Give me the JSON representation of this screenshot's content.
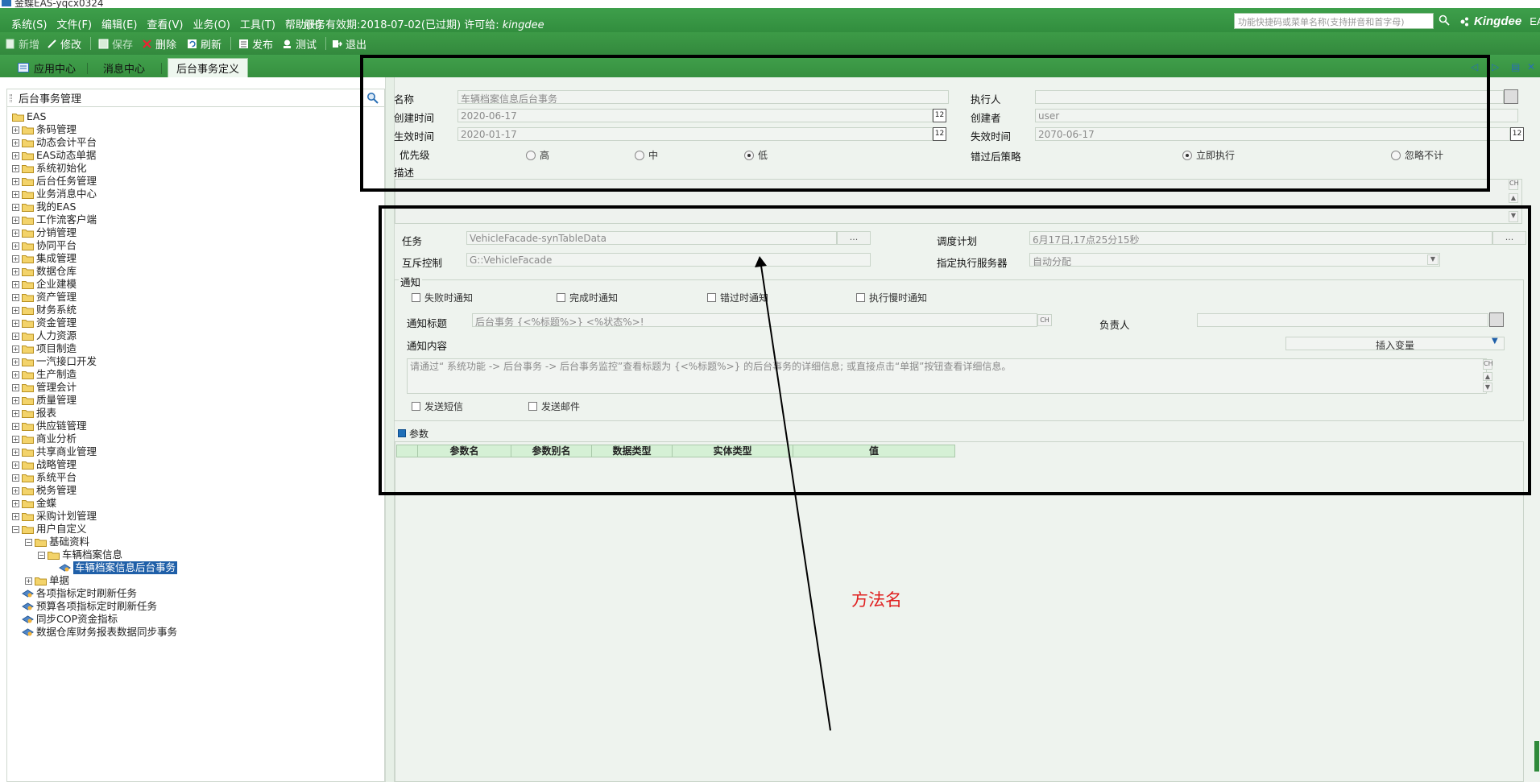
{
  "window": {
    "title": "金蝶EAS-yqcx0324"
  },
  "menubar": {
    "items": [
      "系统(S)",
      "文件(F)",
      "编辑(E)",
      "查看(V)",
      "业务(O)",
      "工具(T)",
      "帮助(H)"
    ],
    "service_text": "服务有效期:2018-07-02(已过期) 许可给:",
    "licensee": "kingdee",
    "quick_placeholder": "功能快捷码或菜单名称(支持拼音和首字母)",
    "brand": "Kingdee",
    "brand_suffix": "EAS"
  },
  "toolbar": {
    "new": "新增",
    "edit": "修改",
    "save": "保存",
    "delete": "删除",
    "refresh": "刷新",
    "publish": "发布",
    "test": "测试",
    "exit": "退出"
  },
  "tabs": [
    "应用中心",
    "消息中心",
    "后台事务定义"
  ],
  "left": {
    "title": "后台事务管理",
    "root": "EAS",
    "folders": [
      "条码管理",
      "动态会计平台",
      "EAS动态单据",
      "系统初始化",
      "后台任务管理",
      "业务消息中心",
      "我的EAS",
      "工作流客户端",
      "分销管理",
      "协同平台",
      "集成管理",
      "数据仓库",
      "企业建模",
      "资产管理",
      "财务系统",
      "资金管理",
      "人力资源",
      "项目制造",
      "一汽接口开发",
      "生产制造",
      "管理会计",
      "质量管理",
      "报表",
      "供应链管理",
      "商业分析",
      "共享商业管理",
      "战略管理",
      "系统平台",
      "税务管理",
      "金蝶",
      "采购计划管理"
    ],
    "user_defined": "用户自定义",
    "basic_data": "基础资料",
    "vehicle_info": "车辆档案信息",
    "selected_task": "车辆档案信息后台事务",
    "bills": "单据",
    "tasks": [
      "各项指标定时刷新任务",
      "预算各项指标定时刷新任务",
      "同步COP资金指标",
      "数据仓库财务报表数据同步事务"
    ]
  },
  "form": {
    "name_label": "名称",
    "name_value": "车辆档案信息后台事务",
    "executor_label": "执行人",
    "executor_value": "",
    "created_label": "创建时间",
    "created_value": "2020-06-17",
    "creator_label": "创建者",
    "creator_value": "user",
    "effective_label": "生效时间",
    "effective_value": "2020-01-17",
    "expire_label": "失效时间",
    "expire_value": "2070-06-17",
    "priority_label": "优先级",
    "priority_high": "高",
    "priority_mid": "中",
    "priority_low": "低",
    "miss_label": "错过后策略",
    "miss_now": "立即执行",
    "miss_ignore": "忽略不计",
    "desc_label": "描述",
    "task_label": "任务",
    "task_value": "VehicleFacade-synTableData",
    "task_btn": "...",
    "schedule_label": "调度计划",
    "schedule_value": "6月17日,17点25分15秒",
    "mutex_label": "互斥控制",
    "mutex_value": "G::VehicleFacade",
    "server_label": "指定执行服务器",
    "server_value": "自动分配",
    "notify_group": "通知",
    "notify_fail": "失败时通知",
    "notify_done": "完成时通知",
    "notify_miss": "错过时通知",
    "notify_slow": "执行慢时通知",
    "notify_title_label": "通知标题",
    "notify_title_value": "后台事务 {<%标题%>} <%状态%>!",
    "owner_label": "负责人",
    "notify_content_label": "通知内容",
    "insert_var": "插入变量",
    "notify_content_value": "请通过“ 系统功能 -> 后台事务 -> 后台事务监控”查看标题为 {<%标题%>} 的后台事务的详细信息; 或直接点击“单据”按钮查看详细信息。",
    "send_sms": "发送短信",
    "send_mail": "发送邮件",
    "ch": "CH"
  },
  "params": {
    "tab": "参数",
    "columns": [
      "参数名",
      "参数别名",
      "数据类型",
      "实体类型",
      "值"
    ]
  },
  "annotation": "方法名"
}
